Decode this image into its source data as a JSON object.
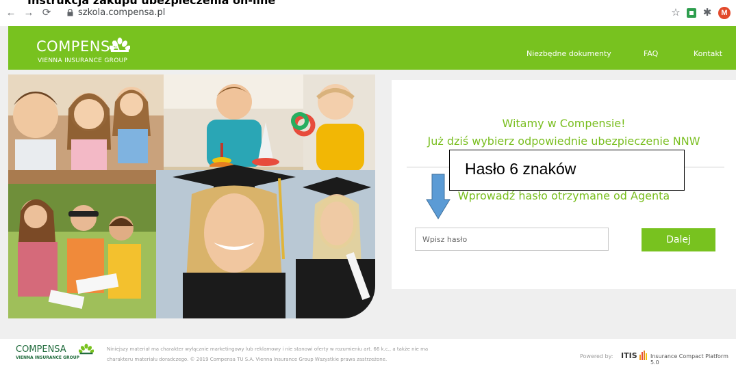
{
  "browser": {
    "url": "szkola.compensa.pl",
    "top_cut_text": "Instrukcja zakupu ubezpieczenia on-line",
    "profile_initial": "M"
  },
  "header": {
    "logo": "COMPENSA",
    "logo_sub": "VIENNA INSURANCE GROUP",
    "nav": [
      "Niezbędne dokumenty",
      "FAQ",
      "Kontakt"
    ]
  },
  "card": {
    "welcome_line1": "Witamy w Compensie!",
    "welcome_line2": "Już dziś wybierz odpowiednie ubezpieczenie NNW",
    "hint": "Wprowadź hasło otrzymane od Agenta",
    "password_placeholder": "Wpisz hasło",
    "next_button": "Dalej"
  },
  "annotation": {
    "text": "Hasło 6 znaków"
  },
  "footer": {
    "logo": "COMPENSA",
    "logo_sub": "VIENNA INSURANCE GROUP",
    "disclaimer1": "Niniejszy materiał ma charakter wyłącznie marketingowy lub reklamowy i nie stanowi oferty w rozumieniu art. 66 k.c., a także nie ma",
    "disclaimer2": "charakteru materiału doradczego. © 2019 Compensa TU S.A. Vienna Insurance Group Wszystkie prawa zastrzeżone.",
    "powered_by": "Powered by:",
    "itis": "ITIS",
    "platform": "Insurance Compact Platform 5.0"
  },
  "colors": {
    "brand_green": "#78c21f",
    "text_green": "#79be1f",
    "footer_green": "#1f6a3b"
  }
}
